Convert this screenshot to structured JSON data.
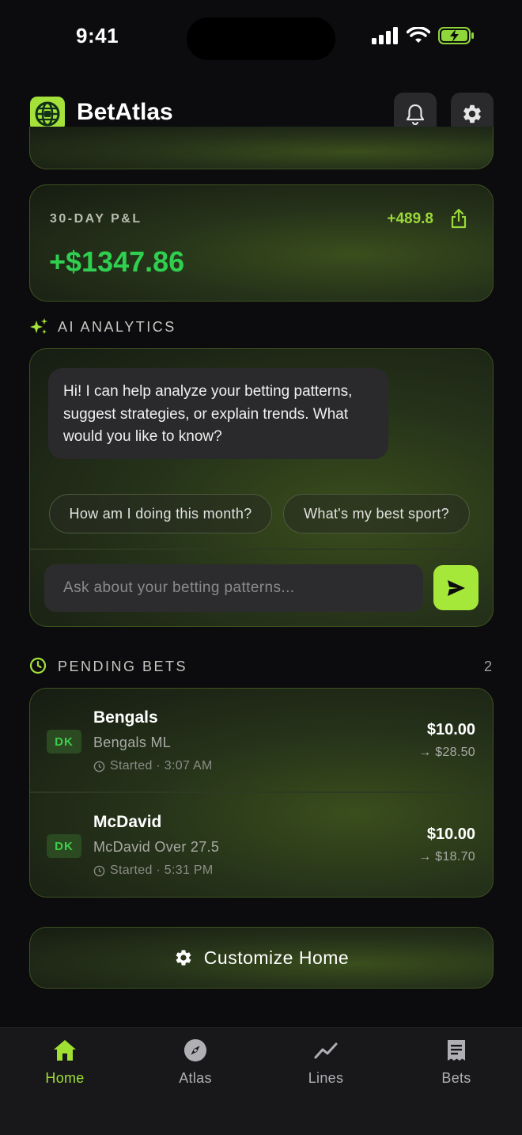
{
  "status_bar": {
    "time": "9:41"
  },
  "header": {
    "app_title": "BetAtlas"
  },
  "pnl": {
    "label": "30-DAY P&L",
    "change": "+489.8",
    "value": "+$1347.86"
  },
  "ai": {
    "section_title": "AI ANALYTICS",
    "message": "Hi! I can help analyze your betting patterns, suggest strategies, or explain trends. What would you like to know?",
    "chips": [
      "How am I doing this month?",
      "What's my best sport?"
    ],
    "input_placeholder": "Ask about your betting patterns..."
  },
  "pending": {
    "section_title": "PENDING BETS",
    "count": "2",
    "bets": [
      {
        "book": "DK",
        "name": "Bengals",
        "type": "Bengals ML",
        "started": "Started · 3:07 AM",
        "stake": "$10.00",
        "payout": "→ $28.50"
      },
      {
        "book": "DK",
        "name": "McDavid",
        "type": "McDavid Over 27.5",
        "started": "Started · 5:31 PM",
        "stake": "$10.00",
        "payout": "→ $18.70"
      }
    ]
  },
  "customize_label": "Customize Home",
  "tabs": [
    {
      "label": "Home",
      "icon": "home-icon",
      "active": true
    },
    {
      "label": "Atlas",
      "icon": "compass-icon",
      "active": false
    },
    {
      "label": "Lines",
      "icon": "trend-icon",
      "active": false
    },
    {
      "label": "Bets",
      "icon": "receipt-icon",
      "active": false
    }
  ],
  "colors": {
    "accent": "#a4e23a",
    "profit": "#2fcf4f",
    "background": "#0c0c0e"
  }
}
